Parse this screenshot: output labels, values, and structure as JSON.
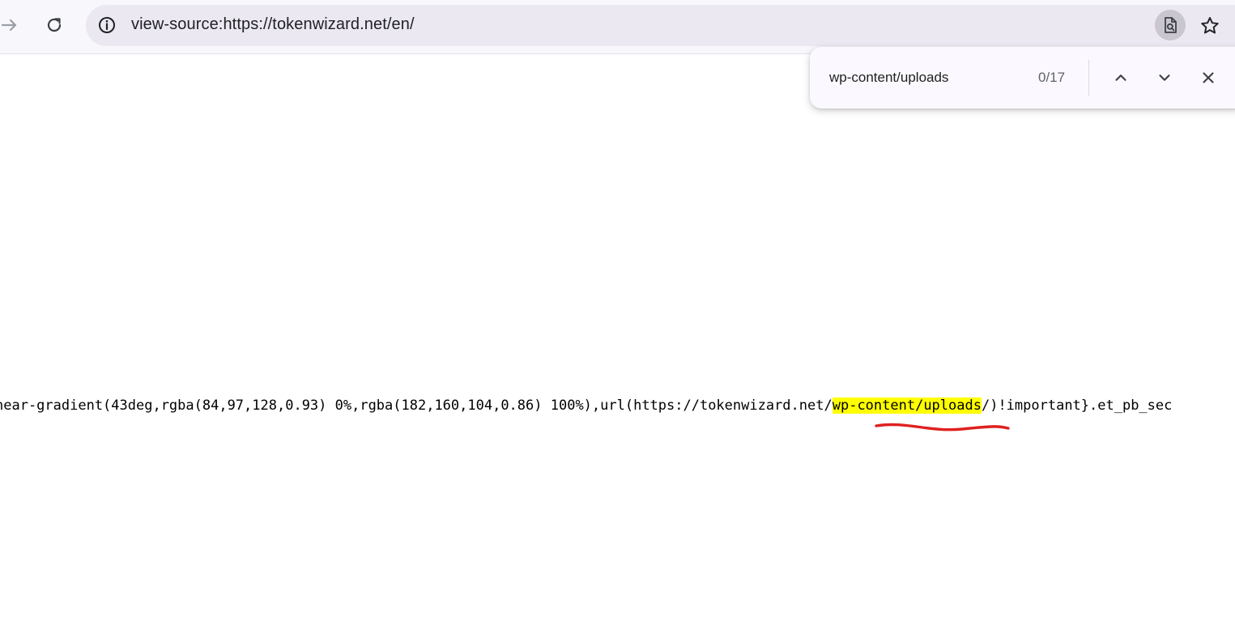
{
  "toolbar": {
    "url": "view-source:https://tokenwizard.net/en/",
    "icons": {
      "forward": "arrow-right-icon",
      "reload": "reload-icon",
      "site_info": "info-icon",
      "view_source": "document-search-icon",
      "bookmark": "star-icon"
    }
  },
  "find_bar": {
    "query": "wp-content/uploads",
    "count": "0/17",
    "icons": {
      "previous": "chevron-up-icon",
      "next": "chevron-down-icon",
      "close": "close-icon"
    }
  },
  "source": {
    "before_match": "near-gradient(43deg,rgba(84,97,128,0.93) 0%,rgba(182,160,104,0.86) 100%),url(https://tokenwizard.net/",
    "match": "wp-content/uploads",
    "after_match": "/)!important}.et_pb_sec"
  },
  "colors": {
    "highlight": "#ffff00",
    "annotation": "#e02020"
  }
}
